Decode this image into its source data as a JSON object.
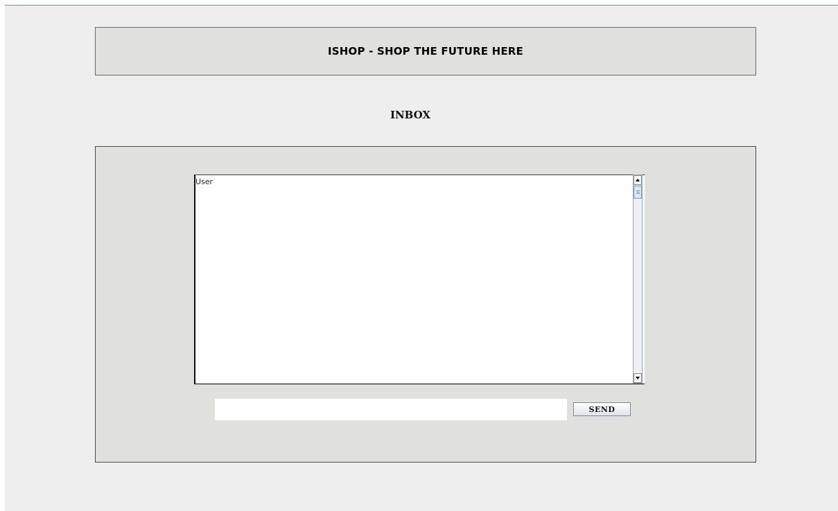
{
  "header": {
    "title": "ISHOP - SHOP THE FUTURE HERE"
  },
  "page": {
    "heading": "INBOX"
  },
  "chat": {
    "content": "User"
  },
  "composer": {
    "input_value": "",
    "send_label": "SEND"
  },
  "colors": {
    "window_bg": "#eeeeee",
    "panel_bg": "#e0e1df",
    "accent_border": "#6f8ea0"
  }
}
